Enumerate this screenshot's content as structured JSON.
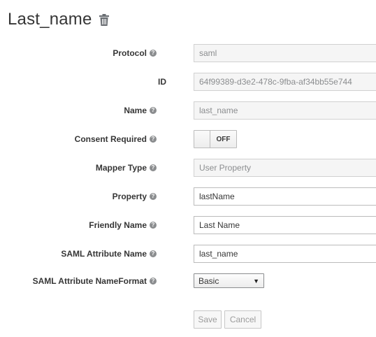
{
  "page": {
    "title": "Last_name"
  },
  "form": {
    "protocol": {
      "label": "Protocol",
      "value": "saml"
    },
    "id": {
      "label": "ID",
      "value": "64f99389-d3e2-478c-9fba-af34bb55e744"
    },
    "name": {
      "label": "Name",
      "value": "last_name"
    },
    "consent_required": {
      "label": "Consent Required",
      "toggle_text": "OFF"
    },
    "mapper_type": {
      "label": "Mapper Type",
      "value": "User Property"
    },
    "property": {
      "label": "Property",
      "value": "lastName"
    },
    "friendly_name": {
      "label": "Friendly Name",
      "value": "Last Name"
    },
    "saml_attribute_name": {
      "label": "SAML Attribute Name",
      "value": "last_name"
    },
    "saml_attribute_nameformat": {
      "label": "SAML Attribute NameFormat",
      "selected": "Basic"
    }
  },
  "actions": {
    "save_label": "Save",
    "cancel_label": "Cancel"
  },
  "icons": {
    "help": "question-circle-icon",
    "delete": "trash-icon"
  },
  "colors": {
    "text": "#363636",
    "help_icon": "#8b8d8f",
    "readonly_bg": "#f5f5f5"
  }
}
